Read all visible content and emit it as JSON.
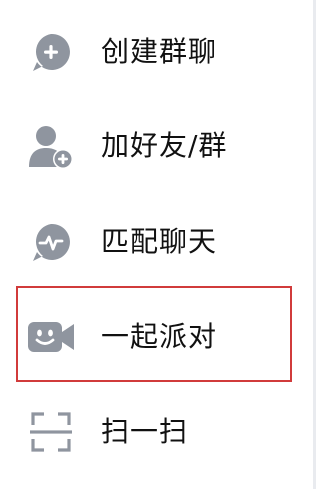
{
  "menu": {
    "items": [
      {
        "id": "create-group",
        "label": "创建群聊",
        "icon": "chat-plus-icon"
      },
      {
        "id": "add-friend",
        "label": "加好友/群",
        "icon": "add-user-icon"
      },
      {
        "id": "match-chat",
        "label": "匹配聊天",
        "icon": "chat-pulse-icon"
      },
      {
        "id": "party",
        "label": "一起派对",
        "icon": "video-camera-smile-icon"
      },
      {
        "id": "scan",
        "label": "扫一扫",
        "icon": "scan-icon"
      }
    ]
  },
  "colors": {
    "icon_gray": "#8f959f",
    "text": "#111111",
    "highlight_border": "#d13b3b"
  }
}
